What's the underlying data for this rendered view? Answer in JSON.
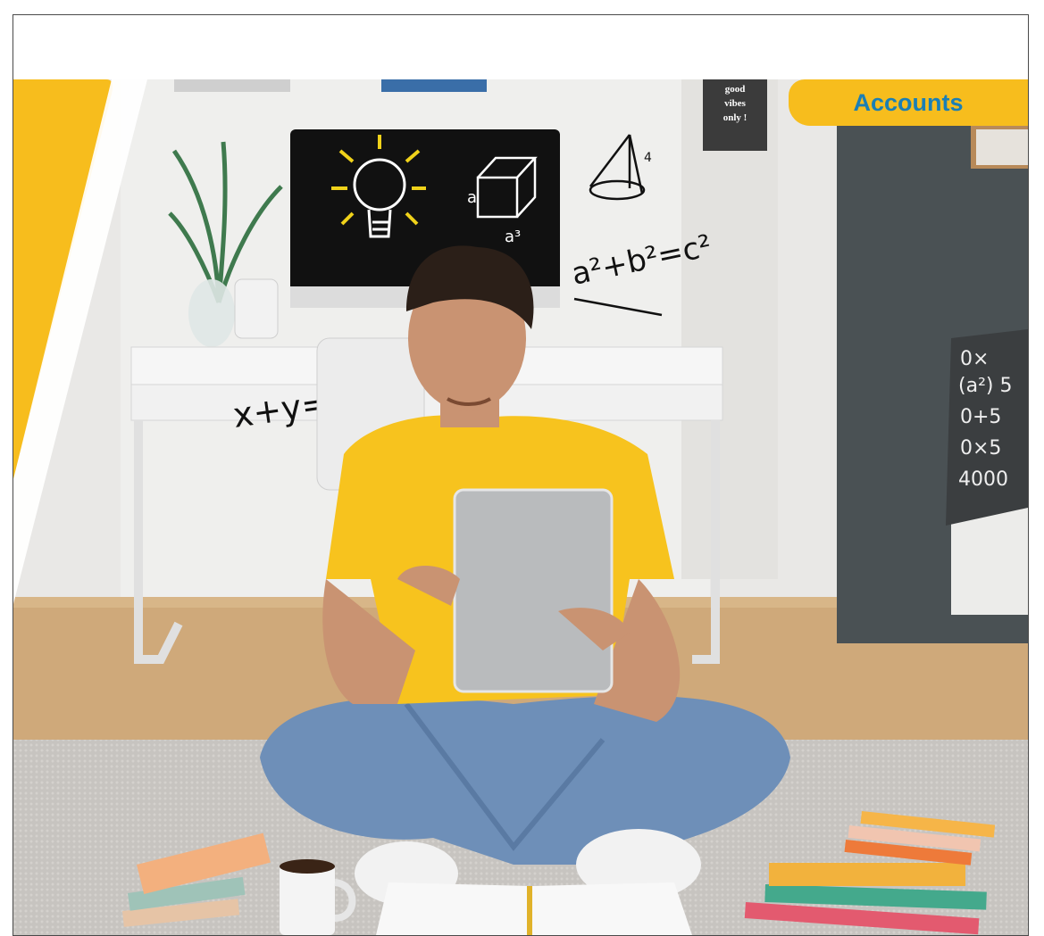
{
  "header": {
    "tab_label": "Accounts"
  },
  "poster": {
    "text": "good vibes only !"
  },
  "chalk_math": {
    "cube_edge": "a",
    "cube_volume": "a³",
    "pythagoras": "a²+b²=c²",
    "desk_equation": "x+y=a²b",
    "cone_label": "4",
    "pillow_math": [
      "0×",
      "(a²) 5",
      "0+5",
      "0×5",
      "4000"
    ]
  },
  "colors": {
    "accent_yellow": "#f7bd1d",
    "tab_text": "#1b7fb5"
  }
}
